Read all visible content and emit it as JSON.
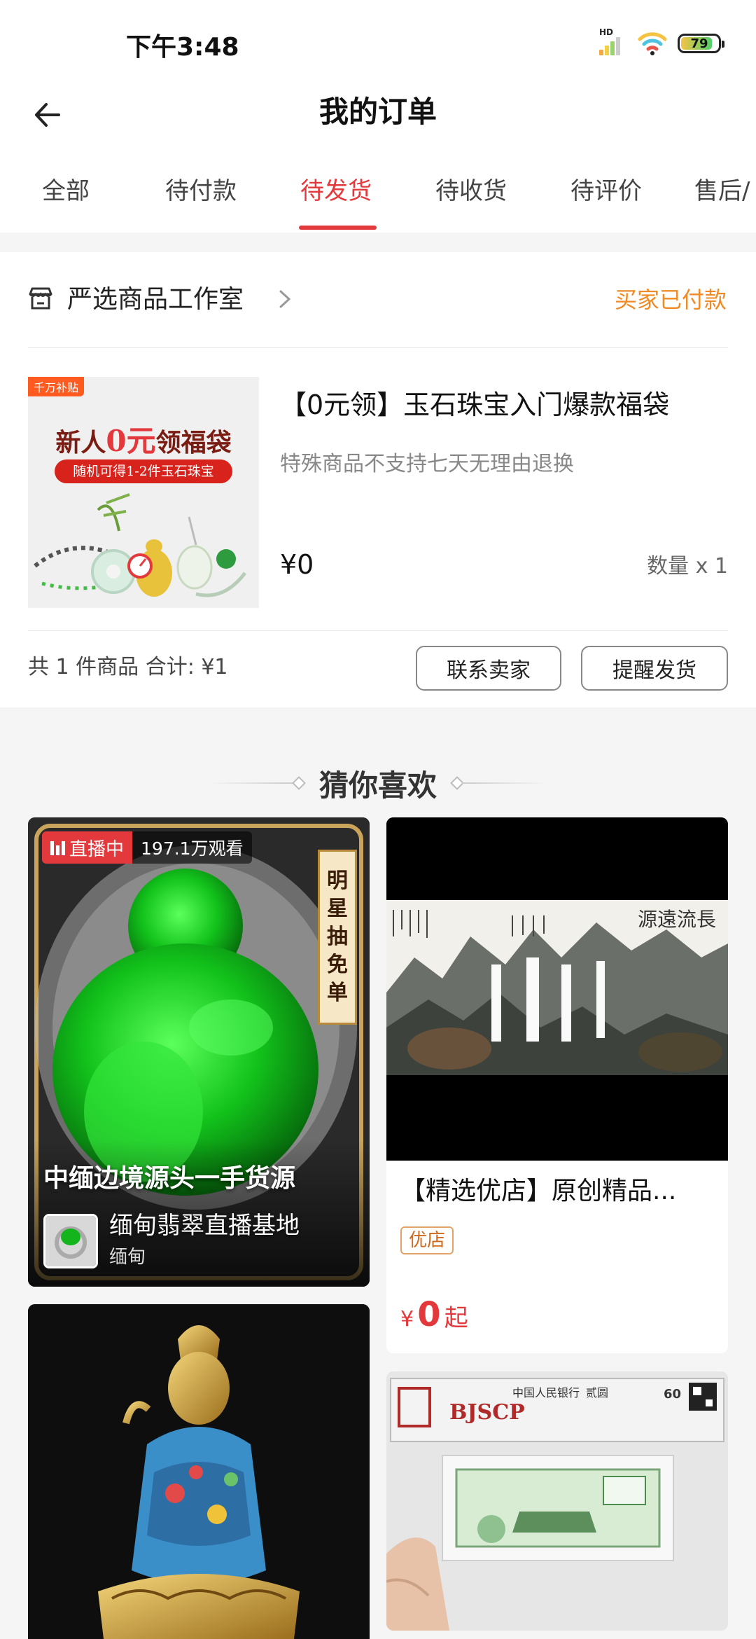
{
  "status_bar": {
    "time": "下午3:48",
    "battery": "79",
    "network": "HD"
  },
  "header": {
    "title": "我的订单"
  },
  "tabs": [
    {
      "label": "全部"
    },
    {
      "label": "待付款"
    },
    {
      "label": "待发货",
      "active": true
    },
    {
      "label": "待收货"
    },
    {
      "label": "待评价"
    },
    {
      "label": "售后/"
    }
  ],
  "order": {
    "shop_name": "严选商品工作室",
    "status": "买家已付款",
    "product": {
      "image_tag": "千万补贴",
      "image_title_prefix": "新人",
      "image_title_highlight": "0元",
      "image_title_suffix": "领福袋",
      "image_subtitle": "随机可得1-2件玉石珠宝",
      "title": "【0元领】玉石珠宝入门爆款福袋",
      "note": "特殊商品不支持七天无理由退换",
      "price": "¥0",
      "quantity": "数量 x 1"
    },
    "summary": "共 1 件商品  合计: ¥1",
    "buttons": {
      "contact": "联系卖家",
      "remind": "提醒发货"
    }
  },
  "recommend": {
    "title": "猜你喜欢",
    "live": {
      "badge": "直播中",
      "viewers": "197.1万观看",
      "banner_chars": [
        "明",
        "星",
        "抽",
        "免",
        "单"
      ],
      "caption": "中缅边境源头一手货源",
      "shop": "缅甸翡翠直播基地",
      "location": "缅甸"
    },
    "painting": {
      "title": "【精选优店】原创精品...",
      "tag": "优店",
      "price_symbol": "¥",
      "price": "0",
      "price_suffix": "起",
      "inscription": "源遠流長"
    },
    "banknote": {
      "grader": "BJSCP",
      "bank": "中国人民银行",
      "denomination": "贰圆",
      "grade": "60"
    }
  },
  "colors": {
    "accent": "#e4393c",
    "status_orange": "#f08a24",
    "tag_orange": "#d0681a"
  }
}
